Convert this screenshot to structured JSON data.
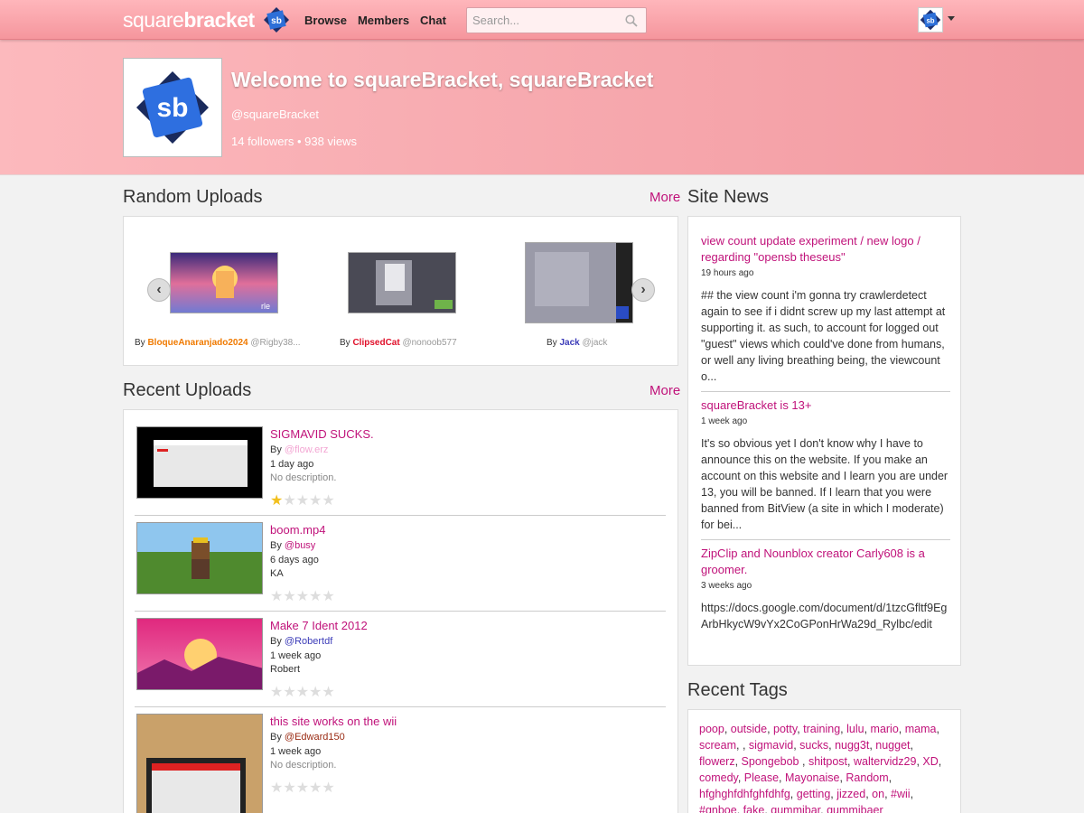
{
  "brand": {
    "word1": "square",
    "word2": "bracket",
    "logo_text": "sb"
  },
  "nav": {
    "browse": "Browse",
    "members": "Members",
    "chat": "Chat"
  },
  "search": {
    "placeholder": "Search..."
  },
  "banner": {
    "title": "Welcome to squareBracket, squareBracket",
    "handle": "@squareBracket",
    "stats": "14 followers • 938 views"
  },
  "random_uploads": {
    "title": "Random Uploads",
    "more": "More",
    "items": [
      {
        "by": "By",
        "name": "BloqueAnaranjado2024",
        "handle": "@Rigby38...",
        "name_color": "#f07a00"
      },
      {
        "by": "By",
        "name": "ClipsedCat",
        "handle": "@nonoob577",
        "name_color": "#e0102a"
      },
      {
        "by": "By",
        "name": "Jack",
        "handle": "@jack",
        "name_color": "#3b3bb8"
      }
    ]
  },
  "recent_uploads": {
    "title": "Recent Uploads",
    "more": "More",
    "items": [
      {
        "title": "SIGMAVID SUCKS.",
        "by": "By",
        "user": "@flow.erz",
        "time": "1 day ago",
        "desc": "No description.",
        "rating": 1
      },
      {
        "title": "boom.mp4",
        "by": "By",
        "user": "@busy",
        "time": "6 days ago",
        "desc": "KA",
        "rating": 0
      },
      {
        "title": "Make 7 Ident 2012",
        "by": "By",
        "user": "@Robertdf",
        "time": "1 week ago",
        "desc": "Robert",
        "rating": 0
      },
      {
        "title": "this site works on the wii",
        "by": "By",
        "user": "@Edward150",
        "time": "1 week ago",
        "desc": "No description.",
        "rating": 0
      }
    ]
  },
  "site_news": {
    "title": "Site News",
    "items": [
      {
        "title": "view count update experiment / new logo / regarding \"opensb theseus\"",
        "time": "19 hours ago",
        "body": "## the view count i'm gonna try crawlerdetect again to see if i didnt screw up my last attempt at supporting it. as such, to account for logged out \"guest\" views which could've done from humans, or well any living breathing being, the viewcount o..."
      },
      {
        "title": "squareBracket is 13+",
        "time": "1 week ago",
        "body": "It's so obvious yet I don't know why I have to announce this on the website. If you make an account on this website and I learn you are under 13, you will be banned. If I learn that you were banned from BitView (a site in which I moderate) for bei..."
      },
      {
        "title": "ZipClip and Nounblox creator Carly608 is a groomer.",
        "time": "3 weeks ago",
        "body": "https://docs.google.com/document/d/1tzcGfltf9EgArbHkycW9vYx2CoGPonHrWa29d_Rylbc/edit"
      }
    ]
  },
  "recent_tags": {
    "title": "Recent Tags",
    "tags": [
      "poop",
      "outside",
      "potty",
      "training",
      "lulu",
      "mario",
      "mama",
      "scream",
      "",
      "sigmavid",
      "sucks",
      "nugg3t",
      "nugget",
      "flowerz",
      "Spongebob ",
      "shitpost",
      "waltervidz29",
      "XD",
      "comedy",
      "Please",
      "Mayonaise",
      "Random",
      "hfghghfdhfghfdhfg",
      "getting",
      "jizzed",
      "on",
      "#wii",
      "#qnboe",
      "fake",
      "gummibar",
      "gummibaer"
    ]
  },
  "colors": {
    "accent": "#c0127a",
    "banner": "#f5a3a9",
    "star_on": "#f2c01e"
  }
}
